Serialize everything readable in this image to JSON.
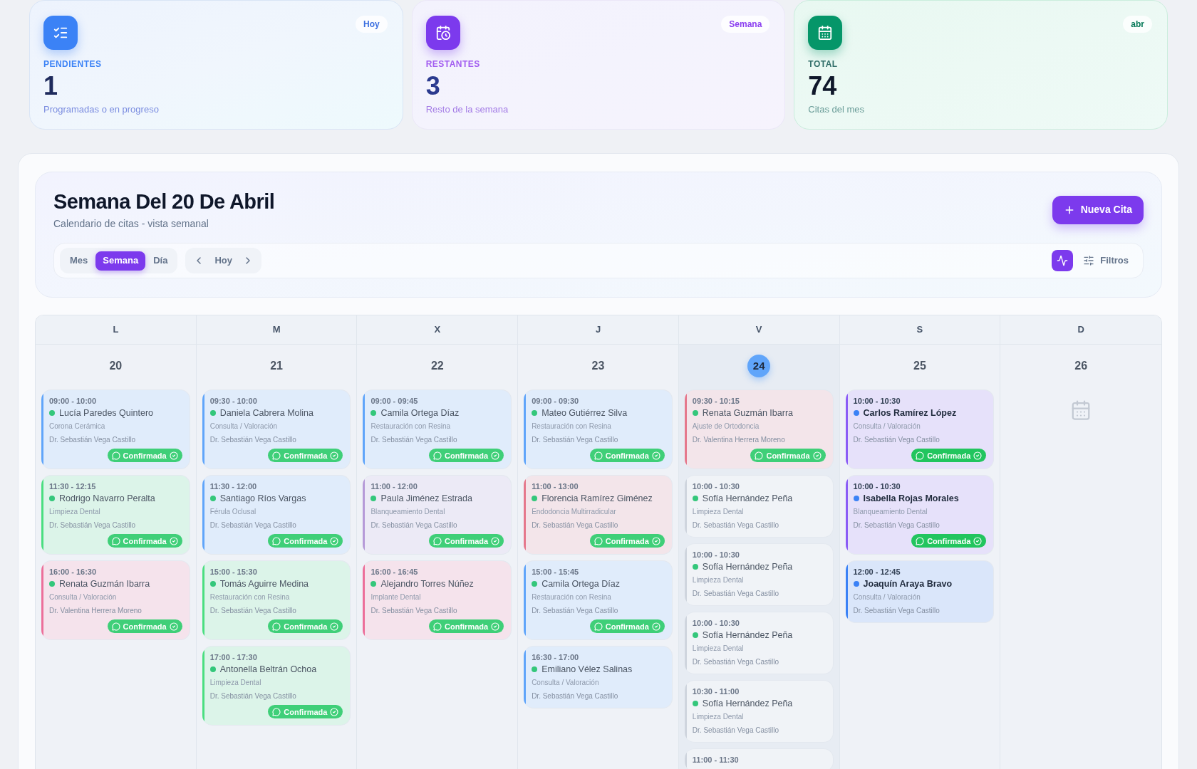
{
  "stats": [
    {
      "kind": "pending",
      "label": "PENDIENTES",
      "value": "1",
      "caption": "Programadas o en progreso",
      "badge": "Hoy"
    },
    {
      "kind": "remaining",
      "label": "RESTANTES",
      "value": "3",
      "caption": "Resto de la semana",
      "badge": "Semana"
    },
    {
      "kind": "total",
      "label": "TOTAL",
      "value": "74",
      "caption": "Citas del mes",
      "badge": "abr"
    }
  ],
  "header": {
    "title": "Semana Del 20 De Abril",
    "subtitle": "Calendario de citas - vista semanal",
    "new_button": "Nueva Cita"
  },
  "view_tabs": [
    {
      "label": "Mes",
      "selected": false
    },
    {
      "label": "Semana",
      "selected": true
    },
    {
      "label": "Día",
      "selected": false
    }
  ],
  "nav": {
    "today": "Hoy"
  },
  "filters": {
    "label": "Filtros"
  },
  "days": [
    {
      "weekday": "L",
      "number": "20",
      "today": false,
      "appointments": [
        {
          "time": "09:00 - 10:00",
          "patient": "Lucía Paredes Quintero",
          "service": "Corona Cerámica",
          "doctor": "Dr. Sebastián Vega Castillo",
          "status": "Confirmada",
          "color": "#60a5fa",
          "dot": {
            "color": "#34c77b"
          },
          "past": true
        },
        {
          "time": "11:30 - 12:15",
          "patient": "Rodrigo Navarro Peralta",
          "service": "Limpieza Dental",
          "doctor": "Dr. Sebastián Vega Castillo",
          "status": "Confirmada",
          "color": "#4ade80",
          "dot": {
            "color": "#34c77b"
          },
          "past": true
        },
        {
          "time": "16:00 - 16:30",
          "patient": "Renata Guzmán Ibarra",
          "service": "Consulta / Valoración",
          "doctor": "Dr. Valentina Herrera Moreno",
          "status": "Confirmada",
          "color": "#ec6f9a",
          "dot": {
            "color": "#34c77b"
          },
          "past": true
        }
      ]
    },
    {
      "weekday": "M",
      "number": "21",
      "today": false,
      "appointments": [
        {
          "time": "09:30 - 10:00",
          "patient": "Daniela Cabrera Molina",
          "service": "Consulta / Valoración",
          "doctor": "Dr. Sebastián Vega Castillo",
          "status": "Confirmada",
          "color": "#60a5fa",
          "dot": {
            "color": "#34c77b"
          },
          "past": true
        },
        {
          "time": "11:30 - 12:00",
          "patient": "Santiago Ríos Vargas",
          "service": "Férula Oclusal",
          "doctor": "Dr. Sebastián Vega Castillo",
          "status": "Confirmada",
          "color": "#60a5fa",
          "dot": {
            "color": "#34c77b"
          },
          "past": true
        },
        {
          "time": "15:00 - 15:30",
          "patient": "Tomás Aguirre Medina",
          "service": "Restauración con Resina",
          "doctor": "Dr. Sebastián Vega Castillo",
          "status": "Confirmada",
          "color": "#4ade80",
          "dot": {
            "color": "#34c77b"
          },
          "past": true
        },
        {
          "time": "17:00 - 17:30",
          "patient": "Antonella Beltrán Ochoa",
          "service": "Limpieza Dental",
          "doctor": "Dr. Sebastián Vega Castillo",
          "status": "Confirmada",
          "color": "#4ade80",
          "dot": {
            "color": "#34c77b"
          },
          "past": true
        }
      ]
    },
    {
      "weekday": "X",
      "number": "22",
      "today": false,
      "appointments": [
        {
          "time": "09:00 - 09:45",
          "patient": "Camila Ortega Díaz",
          "service": "Restauración con Resina",
          "doctor": "Dr. Sebastián Vega Castillo",
          "status": "Confirmada",
          "color": "#60a5fa",
          "dot": {
            "color": "#34c77b"
          },
          "past": true
        },
        {
          "time": "11:00 - 12:00",
          "patient": "Paula Jiménez Estrada",
          "service": "Blanqueamiento Dental",
          "doctor": "Dr. Sebastián Vega Castillo",
          "status": "Confirmada",
          "color": "#b69ad8",
          "dot": {
            "color": "#34c77b"
          },
          "past": true
        },
        {
          "time": "16:00 - 16:45",
          "patient": "Alejandro Torres Núñez",
          "service": "Implante Dental",
          "doctor": "Dr. Sebastián Vega Castillo",
          "status": "Confirmada",
          "color": "#ec6f9a",
          "dot": {
            "color": "#34c77b"
          },
          "past": true
        }
      ]
    },
    {
      "weekday": "J",
      "number": "23",
      "today": false,
      "appointments": [
        {
          "time": "09:00 - 09:30",
          "patient": "Mateo Gutiérrez Silva",
          "service": "Restauración con Resina",
          "doctor": "Dr. Sebastián Vega Castillo",
          "status": "Confirmada",
          "color": "#60a5fa",
          "dot": {
            "color": "#34c77b"
          },
          "past": true
        },
        {
          "time": "11:00 - 13:00",
          "patient": "Florencia Ramírez Giménez",
          "service": "Endodoncia Multirradicular",
          "doctor": "Dr. Sebastián Vega Castillo",
          "status": "Confirmada",
          "color": "#e5788c",
          "dot": {
            "color": "#34c77b"
          },
          "past": true
        },
        {
          "time": "15:00 - 15:45",
          "patient": "Camila Ortega Díaz",
          "service": "Restauración con Resina",
          "doctor": "Dr. Sebastián Vega Castillo",
          "status": "Confirmada",
          "color": "#60a5fa",
          "dot": {
            "color": "#34c77b"
          },
          "past": true
        },
        {
          "time": "16:30 - 17:00",
          "patient": "Emiliano Vélez Salinas",
          "service": "Consulta / Valoración",
          "doctor": "Dr. Sebastián Vega Castillo",
          "color": "#60a5fa",
          "dot": {
            "color": "#34c77b"
          },
          "past": true
        }
      ]
    },
    {
      "weekday": "V",
      "number": "24",
      "today": true,
      "appointments": [
        {
          "time": "09:30 - 10:15",
          "patient": "Renata Guzmán Ibarra",
          "service": "Ajuste de Ortodoncia",
          "doctor": "Dr. Valentina Herrera Moreno",
          "status": "Confirmada",
          "color": "#e5788c",
          "dot": {
            "color": "#34c77b"
          },
          "past": true
        },
        {
          "time": "10:00 - 10:30",
          "patient": "Sofía Hernández Peña",
          "service": "Limpieza Dental",
          "doctor": "Dr. Sebastián Vega Castillo",
          "color": "#cfd5de",
          "dot": {
            "color": "#34c77b"
          },
          "past": true
        },
        {
          "time": "10:00 - 10:30",
          "patient": "Sofía Hernández Peña",
          "service": "Limpieza Dental",
          "doctor": "Dr. Sebastián Vega Castillo",
          "color": "#cfd5de",
          "dot": {
            "color": "#34c77b"
          },
          "past": true
        },
        {
          "time": "10:00 - 10:30",
          "patient": "Sofía Hernández Peña",
          "service": "Limpieza Dental",
          "doctor": "Dr. Sebastián Vega Castillo",
          "color": "#cfd5de",
          "dot": {
            "color": "#34c77b"
          },
          "past": true
        },
        {
          "time": "10:30 - 11:00",
          "patient": "Sofía Hernández Peña",
          "service": "Limpieza Dental",
          "doctor": "Dr. Sebastián Vega Castillo",
          "color": "#cfd5de",
          "dot": {
            "color": "#34c77b"
          },
          "past": true
        },
        {
          "time": "11:00 - 11:30",
          "color": "#cfd5de",
          "past": true
        }
      ]
    },
    {
      "weekday": "S",
      "number": "25",
      "today": false,
      "appointments": [
        {
          "time": "10:00 - 10:30",
          "patient": "Carlos Ramírez López",
          "service": "Consulta / Valoración",
          "doctor": "Dr. Sebastián Vega Castillo",
          "status": "Confirmada",
          "color": "#8b5cf6",
          "dot": {
            "color": "#3b82f6"
          },
          "past": false
        },
        {
          "time": "10:00 - 10:30",
          "patient": "Isabella Rojas Morales",
          "service": "Blanqueamiento Dental",
          "doctor": "Dr. Sebastián Vega Castillo",
          "status": "Confirmada",
          "color": "#8b5cf6",
          "dot": {
            "color": "#3b82f6"
          },
          "past": false
        },
        {
          "time": "12:00 - 12:45",
          "patient": "Joaquín Araya Bravo",
          "service": "Consulta / Valoración",
          "doctor": "Dr. Sebastián Vega Castillo",
          "color": "#3b82f6",
          "dot": {
            "color": "#3b82f6"
          },
          "past": false
        }
      ]
    },
    {
      "weekday": "D",
      "number": "26",
      "today": false
    }
  ]
}
